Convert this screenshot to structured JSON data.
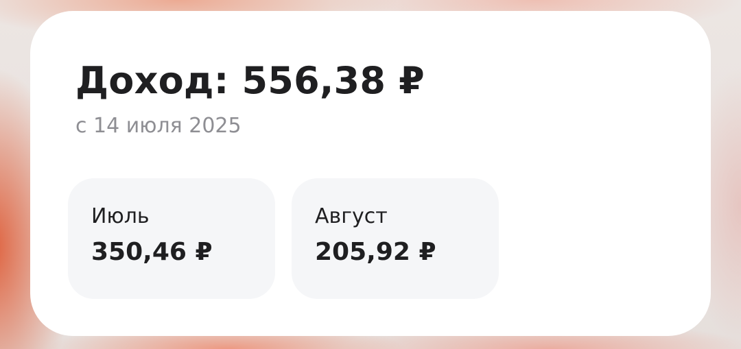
{
  "income": {
    "title": "Доход: 556,38 ₽",
    "subtitle": "с 14 июля 2025"
  },
  "months": [
    {
      "label": "Июль",
      "value": "350,46 ₽"
    },
    {
      "label": "Август",
      "value": "205,92 ₽"
    }
  ],
  "colors": {
    "card_background": "#ffffff",
    "tile_background": "#f5f6f8",
    "primary_text": "#1f1f21",
    "secondary_text": "#8e8e93",
    "backdrop_accent": "#de5c37"
  }
}
